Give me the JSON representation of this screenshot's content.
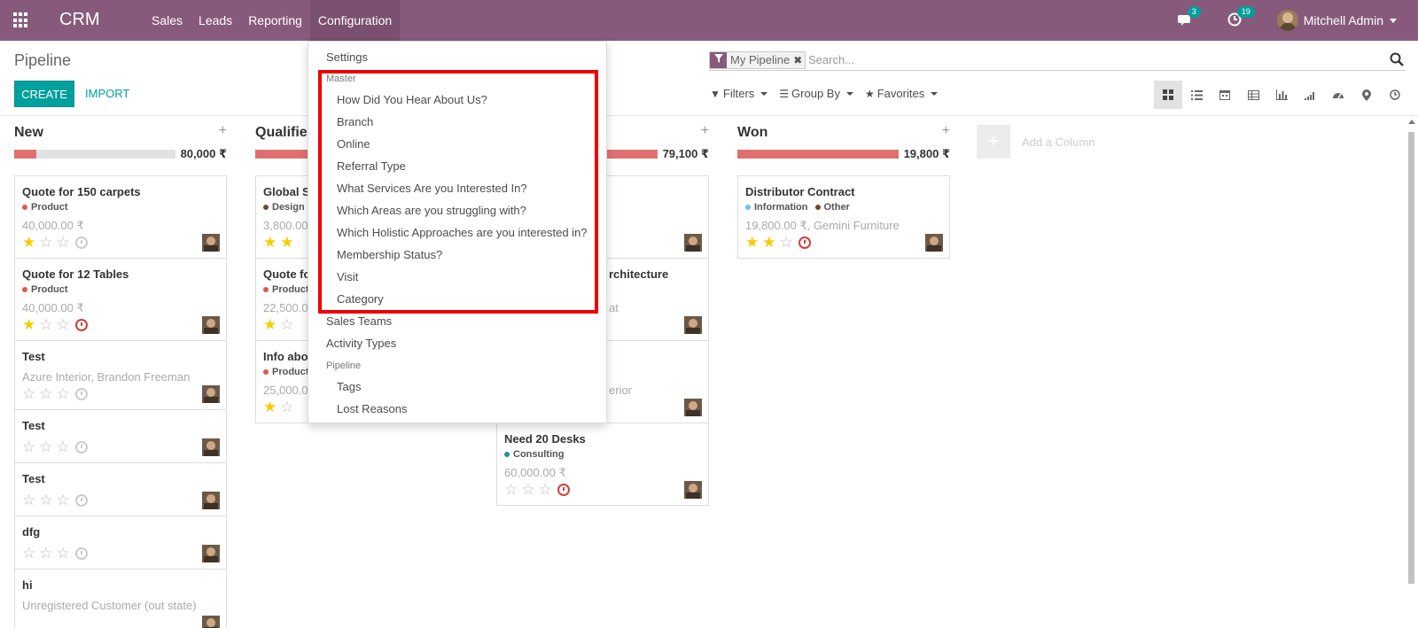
{
  "navbar": {
    "brand": "CRM",
    "menu": [
      "Sales",
      "Leads",
      "Reporting",
      "Configuration"
    ],
    "messages_count": "3",
    "activities_count": "19",
    "user": "Mitchell Admin"
  },
  "control_panel": {
    "breadcrumb": "Pipeline",
    "create": "CREATE",
    "import": "IMPORT",
    "facet": "My Pipeline",
    "facet_remove": "✖",
    "search_placeholder": "Search...",
    "filters": "Filters",
    "group_by": "Group By",
    "favorites": "Favorites"
  },
  "columns": [
    {
      "title": "New",
      "sum": "80,000 ₹",
      "progress": 0.14
    },
    {
      "title": "Qualified",
      "sum": "",
      "progress": 1.0
    },
    {
      "title": "",
      "sum": "79,100 ₹",
      "progress": 1.0
    },
    {
      "title": "Won",
      "sum": "19,800 ₹",
      "progress": 1.0
    }
  ],
  "cards": {
    "new": [
      {
        "title": "Quote for 150 carpets",
        "tag": "Product",
        "sub": "40,000.00 ₹",
        "stars": 1,
        "overdue": false
      },
      {
        "title": "Quote for 12 Tables",
        "tag": "Product",
        "sub": "40,000.00 ₹",
        "stars": 1,
        "overdue": true
      },
      {
        "title": "Test",
        "sub": "Azure Interior, Brandon Freeman",
        "stars": 0,
        "overdue": false
      },
      {
        "title": "Test",
        "stars": 0,
        "overdue": false
      },
      {
        "title": "Test",
        "stars": 0,
        "overdue": false
      },
      {
        "title": "dfg",
        "stars": 0,
        "overdue": false
      },
      {
        "title": "hi",
        "sub": "Unregistered Customer (out state)"
      }
    ],
    "qualified": [
      {
        "title": "Global So",
        "tag": "Design",
        "sub": "3,800.00",
        "stars": 2
      },
      {
        "title": "Quote fo",
        "tag": "Product",
        "sub": "22,500.00",
        "stars": 1
      },
      {
        "title": "Info about",
        "tag": "Product",
        "sub": "25,000.0",
        "stars": 1
      }
    ],
    "proposition": [
      {
        "title": "",
        "sub": ""
      },
      {
        "title": "rchitecture",
        "sub": "at"
      },
      {
        "title": "",
        "sub": "erior"
      },
      {
        "title": "Need 20 Desks",
        "tag": "Consulting",
        "sub": "60,000.00 ₹",
        "stars": 0,
        "overdue": true
      }
    ],
    "won": [
      {
        "title": "Distributor Contract",
        "tag": "Information",
        "tag2": "Other",
        "sub": "19,800.00 ₹, Gemini Furniture",
        "stars": 2,
        "overdue": true
      }
    ]
  },
  "add_column": "Add a Column",
  "dropdown": {
    "settings": "Settings",
    "master_header": "Master",
    "master_items": [
      "How Did You Hear About Us?",
      "Branch",
      "Online",
      "Referral Type",
      "What Services Are you Interested In?",
      "Which Areas are you struggling with?",
      "Which Holistic Approaches are you interested in?",
      "Membership Status?",
      "Visit",
      "Category"
    ],
    "sales_teams": "Sales Teams",
    "activity_types": "Activity Types",
    "pipeline_header": "Pipeline",
    "pipeline_items": [
      "Tags",
      "Lost Reasons"
    ]
  },
  "colors": {
    "navbar": "#875a7b",
    "accent": "#00a09d",
    "progress": "#e07070",
    "highlight": "#ee0000"
  }
}
